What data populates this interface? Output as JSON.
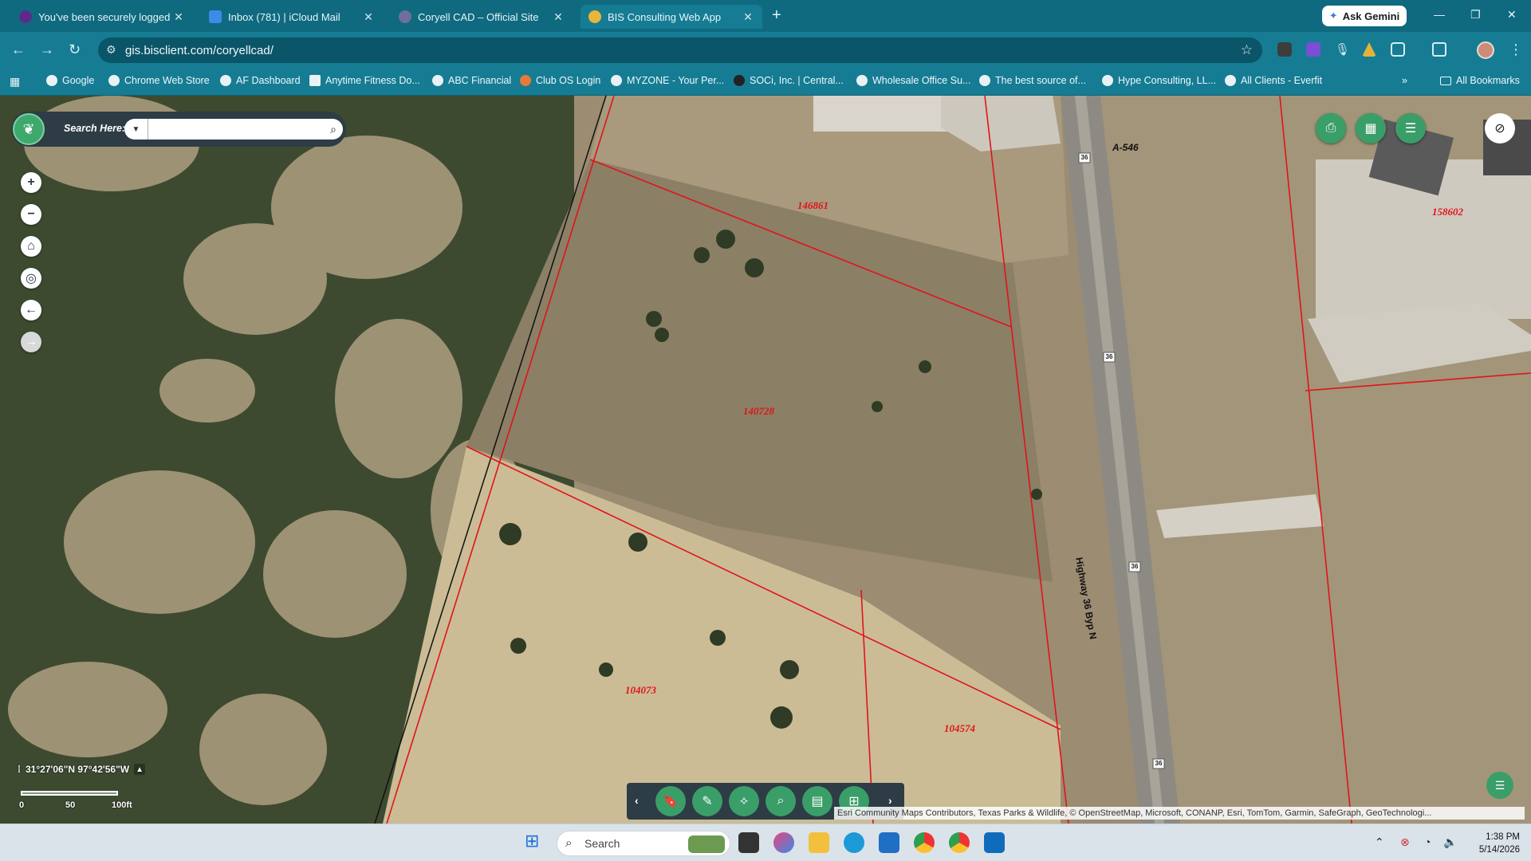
{
  "browser": {
    "tabs": [
      {
        "title": "You've been securely logged o",
        "favicon_color": "#5b2b8c"
      },
      {
        "title": "Inbox (781) | iCloud Mail",
        "favicon_color": "#3b8be8"
      },
      {
        "title": "Coryell CAD – Official Site",
        "favicon_color": "#6f6f9c"
      },
      {
        "title": "BIS Consulting Web App",
        "favicon_color": "#e9b53b"
      }
    ],
    "new_tab_label": "+",
    "ask_gemini_label": "Ask Gemini",
    "url": "gis.bisclient.com/coryellcad/",
    "bookmarks": [
      {
        "label": "Google"
      },
      {
        "label": "Chrome Web Store"
      },
      {
        "label": "AF Dashboard"
      },
      {
        "label": "Anytime Fitness Do..."
      },
      {
        "label": "ABC Financial"
      },
      {
        "label": "Club OS Login"
      },
      {
        "label": "MYZONE - Your Per..."
      },
      {
        "label": "SOCi, Inc. | Central..."
      },
      {
        "label": "Wholesale Office Su..."
      },
      {
        "label": "The best source of..."
      },
      {
        "label": "Hype Consulting, LL..."
      },
      {
        "label": "All Clients - Everfit"
      }
    ],
    "more_bookmarks_label": "»",
    "all_bookmarks_label": "All Bookmarks"
  },
  "map": {
    "search": {
      "label": "Search Here:",
      "value": "",
      "placeholder": ""
    },
    "parcels": [
      "146861",
      "158602",
      "140728",
      "104073",
      "104574"
    ],
    "road_labels": {
      "a546": "A-546",
      "highway": "Highway 36 Byp N"
    },
    "route_shields": [
      "36",
      "36",
      "36",
      "36"
    ],
    "coordinates": "31°27'06\"N 97°42'56\"W",
    "scale_labels": [
      "0",
      "50",
      "100ft"
    ],
    "attribution": "Esri Community Maps Contributors, Texas Parks & Wildlife, © OpenStreetMap, Microsoft, CONANP, Esri, TomTom, Garmin, SafeGraph, GeoTechnologi..."
  },
  "taskbar": {
    "search_label": "Search",
    "time": "1:38 PM",
    "date": "5/14/2026"
  }
}
